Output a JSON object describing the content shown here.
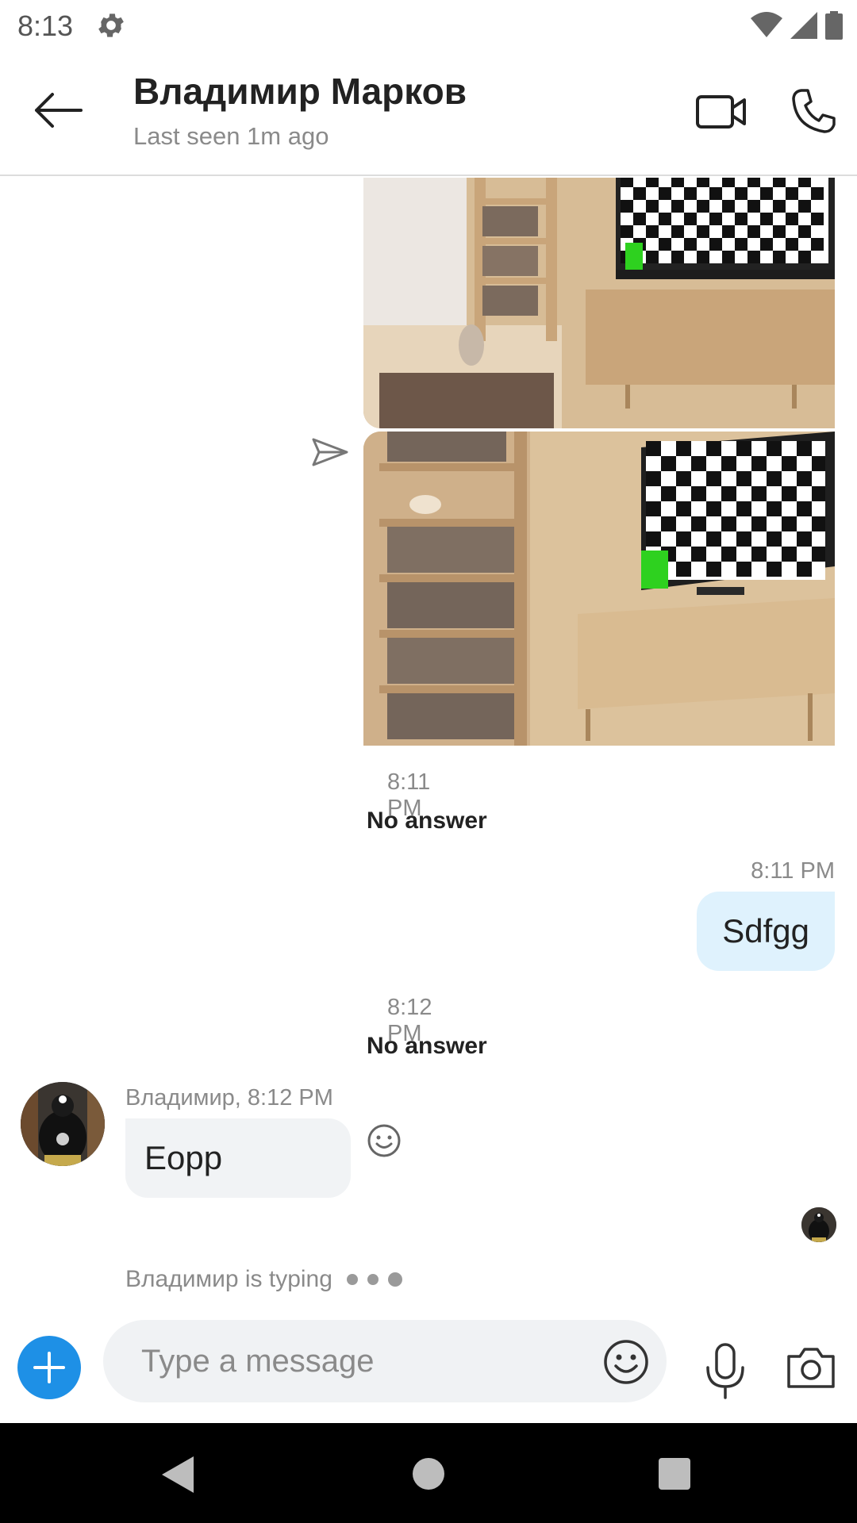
{
  "status_bar": {
    "time": "8:13",
    "icons": [
      "gear-icon",
      "wifi-icon",
      "signal-icon",
      "battery-icon"
    ]
  },
  "header": {
    "contact_name": "Владимир Марков",
    "last_seen": "Last seen 1m ago",
    "icons": [
      "back-arrow-icon",
      "video-call-icon",
      "phone-call-icon"
    ]
  },
  "messages": [
    {
      "type": "images",
      "direction": "outgoing",
      "count": 2,
      "status_icon": "sent-icon"
    },
    {
      "type": "call",
      "time": "8:11 PM",
      "status": "No answer"
    },
    {
      "type": "text",
      "direction": "outgoing",
      "time": "8:11 PM",
      "text": "Sdfgg"
    },
    {
      "type": "call",
      "time": "8:12 PM",
      "status": "No answer"
    },
    {
      "type": "text",
      "direction": "incoming",
      "meta": "Владимир, 8:12 PM",
      "text": "Eopp",
      "reaction_icon": "smiley-icon"
    }
  ],
  "typing_indicator": "Владимир is typing",
  "composer": {
    "placeholder": "Type a message",
    "icons": [
      "plus-icon",
      "emoji-icon",
      "microphone-icon",
      "camera-icon"
    ]
  },
  "colors": {
    "accent": "#1e90e6",
    "outgoing_bubble": "#dff2fd",
    "incoming_bubble": "#f1f3f5",
    "muted_text": "#8a8a8a"
  }
}
